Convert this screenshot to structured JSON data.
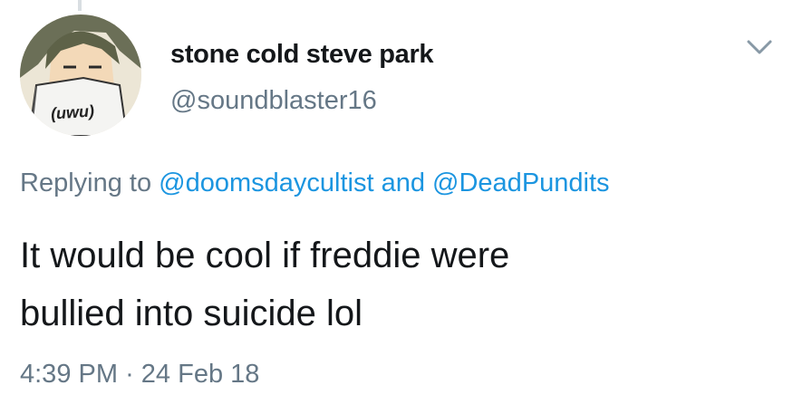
{
  "tweet": {
    "avatar_caption": "(uwu)",
    "display_name": "stone cold steve park",
    "handle": "@soundblaster16",
    "reply": {
      "prefix": "Replying to",
      "mention_1": "@doomsdaycultist",
      "conjunction": "and",
      "mention_2": "@DeadPundits"
    },
    "text_lines": [
      "It would be cool if freddie were",
      "bullied into suicide lol"
    ],
    "time": "4:39 PM",
    "separator": "·",
    "date": "24 Feb 18"
  },
  "colors": {
    "link": "#1b95e0",
    "secondary_text": "#657786",
    "primary_text": "#14171a"
  },
  "icons": {
    "menu": "chevron-down-icon"
  }
}
